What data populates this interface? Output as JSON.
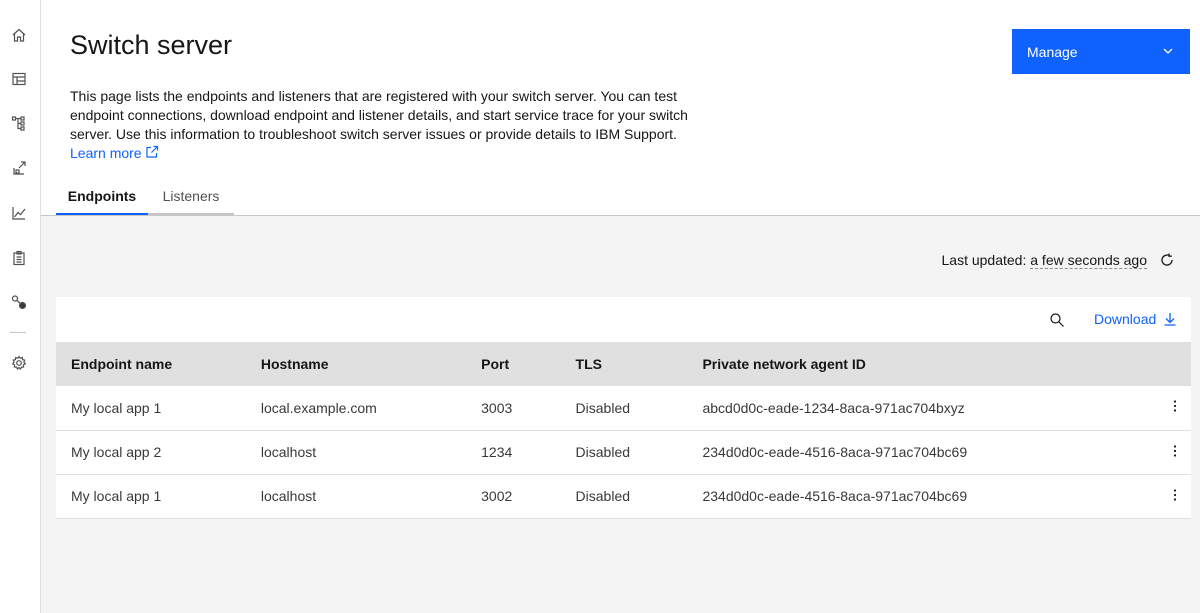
{
  "sidenav": {
    "icons": [
      "home-icon",
      "dashboard-icon",
      "hierarchy-icon",
      "upload-icon",
      "chart-line-icon",
      "clipboard-icon",
      "connection-icon",
      "settings-icon"
    ]
  },
  "header": {
    "title": "Switch server",
    "manage_label": "Manage",
    "description": "This page lists the endpoints and listeners that are registered with your switch server. You can test endpoint connections, download endpoint and listener details, and start service trace for your switch server. Use this information to troubleshoot switch server issues or provide details to IBM Support.",
    "learn_more": "Learn more"
  },
  "tabs": [
    {
      "label": "Endpoints",
      "active": true
    },
    {
      "label": "Listeners",
      "active": false
    }
  ],
  "status": {
    "last_updated_label": "Last updated:",
    "last_updated_value": "a few seconds ago"
  },
  "toolbar": {
    "download_label": "Download"
  },
  "table": {
    "columns": [
      "Endpoint name",
      "Hostname",
      "Port",
      "TLS",
      "Private network agent ID"
    ],
    "rows": [
      {
        "name": "My local app 1",
        "host": "local.example.com",
        "port": "3003",
        "tls": "Disabled",
        "agent": "abcd0d0c-eade-1234-8aca-971ac704bxyz"
      },
      {
        "name": "My local app 2",
        "host": "localhost",
        "port": "1234",
        "tls": "Disabled",
        "agent": "234d0d0c-eade-4516-8aca-971ac704bc69"
      },
      {
        "name": "My local app 1",
        "host": "localhost",
        "port": "3002",
        "tls": "Disabled",
        "agent": "234d0d0c-eade-4516-8aca-971ac704bc69"
      }
    ]
  },
  "colors": {
    "accent": "#0f62fe",
    "content_bg": "#f4f4f4",
    "header_row": "#e0e0e0"
  }
}
